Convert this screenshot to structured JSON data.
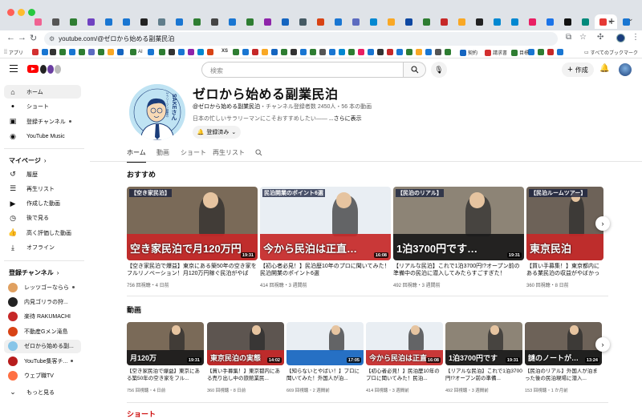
{
  "browser": {
    "url": "youtube.com/@ゼロから始める副業民泊",
    "bookmark_apps": "アプリ",
    "bookmarks": [
      {
        "label": "AI",
        "color": "#2e7d32"
      },
      {
        "label": "XS",
        "color": "#222222"
      },
      {
        "label": "契約",
        "color": "#1565c0"
      },
      {
        "label": "請求書",
        "color": "#d32f2f"
      },
      {
        "label": "目標",
        "color": "#2e7d32"
      }
    ],
    "all_bookmarks": "すべてのブックマーク",
    "tab_colors": [
      "#f06292",
      "#555555",
      "#2e7d32",
      "#6f42c1",
      "#1976d2",
      "#1976d2",
      "#222222",
      "#607d8b",
      "#1976d2",
      "#2e7d32",
      "#444444",
      "#1976d2",
      "#2e7d32",
      "#8e24aa",
      "#1565c0",
      "#455a64",
      "#d84315",
      "#1976d2",
      "#5c6bc0",
      "#0288d1",
      "#f9a825",
      "#0d47a1",
      "#2e7d32",
      "#c62828",
      "#f9a825",
      "#222222",
      "#0288d1",
      "#0288d1",
      "#e91e63",
      "#1a73e8",
      "#111111",
      "#00897b",
      "#e53935",
      "#1976d2"
    ]
  },
  "header": {
    "search_placeholder": "検索",
    "create_label": "作成"
  },
  "sidebar": {
    "main": [
      {
        "label": "ホーム",
        "icon": "home-icon",
        "glyph": "⌂"
      },
      {
        "label": "ショート",
        "icon": "shorts-icon",
        "glyph": "ꔷ"
      },
      {
        "label": "登録チャンネル",
        "icon": "subscriptions-icon",
        "glyph": "▣"
      },
      {
        "label": "YouTube Music",
        "icon": "youtube-music-icon",
        "glyph": "◉"
      }
    ],
    "you_section": "マイページ",
    "you": [
      {
        "label": "履歴",
        "icon": "history-icon",
        "glyph": "↺"
      },
      {
        "label": "再生リスト",
        "icon": "playlist-icon",
        "glyph": "☰"
      },
      {
        "label": "作成した動画",
        "icon": "your-videos-icon",
        "glyph": "▶"
      },
      {
        "label": "後で見る",
        "icon": "watch-later-icon",
        "glyph": "◷"
      },
      {
        "label": "高く評価した動画",
        "icon": "liked-icon",
        "glyph": "👍"
      },
      {
        "label": "オフライン",
        "icon": "download-icon",
        "glyph": "⤓"
      }
    ],
    "subs_section": "登録チャンネル",
    "subs": [
      {
        "label": "レッツゴーならら",
        "color": "#e0a060"
      },
      {
        "label": "内見ゴリラの狩...",
        "color": "#222222"
      },
      {
        "label": "楽待 RAKUMACHI",
        "color": "#c62828"
      },
      {
        "label": "不動産Gメン滝島",
        "color": "#d84315"
      },
      {
        "label": "ゼロから始める副...",
        "color": "#87c5e8"
      },
      {
        "label": "YouTube集客チ...",
        "color": "#b71c1c"
      },
      {
        "label": "ウェブ職TV",
        "color": "#ff7043"
      }
    ],
    "more": "もっと見る"
  },
  "channel": {
    "name": "ゼロから始める副業民泊",
    "handle": "@ゼロから始める副業民泊",
    "meta": "・チャンネル登録者数 2450人・56 本の動画",
    "description": "日本の忙しいサラリーマンにこそおすすめしたい—— ",
    "more": "...さらに表示",
    "subscribe_label": "登録済み",
    "avatar_text": "SAKEさん",
    "avatar_subtext": "サラリーマン副業の"
  },
  "tabs": [
    "ホーム",
    "動画",
    "ショート",
    "再生リスト"
  ],
  "recommended": {
    "title": "おすすめ",
    "videos": [
      {
        "title": "【空き家民泊で爆益】東京にある築50年の空き家をフルリノベーション！月120万円稼ぐ民泊がやばす...",
        "meta": "756 回視聴・4 日前",
        "duration": "19:31",
        "thumb_text": "空き家民泊で月120万円",
        "tag": "【空き家民泊】",
        "bg": "#7a6a58",
        "txt": "#ffffff",
        "band": "#c62828"
      },
      {
        "title": "【初心者必見！】民泊歴10年のプロに聞いてみた！民泊開業のポイント6選",
        "meta": "414 回視聴・3 週間前",
        "duration": "16:08",
        "thumb_text": "今から民泊は正直…",
        "tag": "民泊開業のポイント6選",
        "bg": "#e9eef3",
        "txt": "#ffffff",
        "band": "#c62828"
      },
      {
        "title": "【リアルな民泊】これで1泊3700円!?オープン前の準備中の民泊に潜入してみたらすごすぎた！",
        "meta": "492 回視聴・3 週間前",
        "duration": "19:31",
        "thumb_text": "1泊3700円です…",
        "tag": "【民泊のリアル】",
        "bg": "#8d8476",
        "txt": "#ffffff",
        "band": "#1a1a1a"
      },
      {
        "title": "【買い手募集！】東京都内にある業民泊の収益がやばかった件につ...",
        "meta": "360 回視聴・8 日前",
        "duration": "",
        "thumb_text": "東京民泊",
        "tag": "【民泊ルームツアー】",
        "bg": "#6d6258",
        "txt": "#ffffff",
        "band": "#c62828"
      }
    ]
  },
  "videos_shelf": {
    "title": "動画",
    "videos": [
      {
        "title": "【空き家民泊で爆益】東京にある築50年の空き家をフル...",
        "meta": "756 回視聴・4 日前",
        "duration": "19:31",
        "thumb_text": "月120万",
        "bg": "#7a6a58",
        "band": "#1a1a1a"
      },
      {
        "title": "【買い手募集！】東京都内にある売り出し中の旅館業民...",
        "meta": "360 回視聴・8 日前",
        "duration": "14:02",
        "thumb_text": "東京民泊の実態",
        "bg": "#5d5550",
        "band": "#c62828"
      },
      {
        "title": "【知らないとやばい！】プロに聞いてみた！外国人が泊...",
        "meta": "669 回視聴・2 週間前",
        "duration": "17:05",
        "thumb_text": "",
        "bg": "#e9eef3",
        "band": "#1565c0"
      },
      {
        "title": "【初心者必見！】民泊歴10年のプロに聞いてみた！民泊...",
        "meta": "414 回視聴・3 週間前",
        "duration": "16:08",
        "thumb_text": "今から民泊は正直",
        "bg": "#e9eef3",
        "band": "#c62828"
      },
      {
        "title": "【リアルな民泊】これで1泊3700円!?オープン前の準備...",
        "meta": "492 回視聴・3 週間前",
        "duration": "19:31",
        "thumb_text": "1泊3700円です",
        "bg": "#8d8476",
        "band": "#1a1a1a"
      },
      {
        "title": "【民泊のリアル】外国人が泊まった後の民泊現場に潜入...",
        "meta": "153 回視聴・1 か月前",
        "duration": "13:24",
        "thumb_text": "謎のノートが…",
        "bg": "#6d6258",
        "band": "#1a1a1a"
      }
    ]
  },
  "shorts_title": "ショート"
}
